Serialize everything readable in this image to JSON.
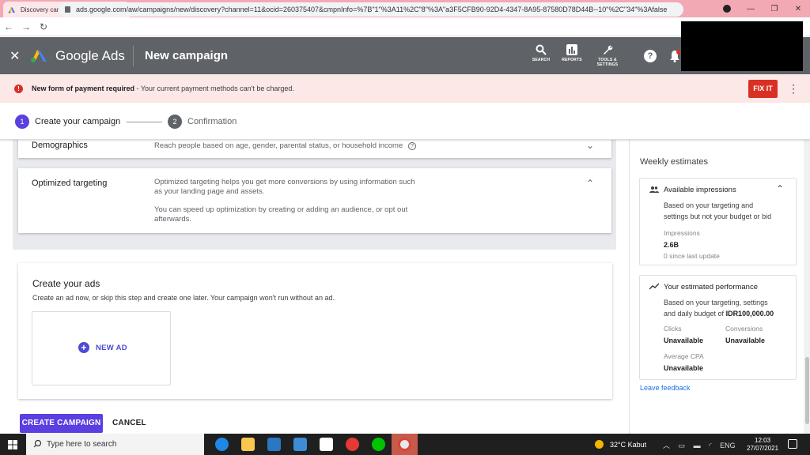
{
  "browser": {
    "tab_title": "Discovery campaign - Getrich - G",
    "url": "ads.google.com/aw/campaigns/new/discovery?channel=11&ocid=260375407&cmpnInfo=%7B\"1\"%3A11%2C\"8\"%3A\"a3F5CFB90-92D4-4347-8A95-87580D78D44B--10\"%2C\"34\"%3Afalse"
  },
  "header": {
    "brand": "Google Ads",
    "page_title": "New campaign",
    "tools": [
      "SEARCH",
      "REPORTS",
      "TOOLS & SETTINGS"
    ]
  },
  "banner": {
    "bold": "New form of payment required",
    "rest": " - Your current payment methods can't be charged.",
    "fix_label": "FIX IT"
  },
  "stepper": {
    "step1_num": "1",
    "step1_label": "Create your campaign",
    "step2_num": "2",
    "step2_label": "Confirmation"
  },
  "targeting": {
    "demographics_label": "Demographics",
    "demographics_desc": "Reach people based on age, gender, parental status, or household income",
    "optimized_label": "Optimized targeting",
    "optimized_desc1_line1": "Optimized targeting helps you get more conversions by using information such",
    "optimized_desc1_line2": "as your landing page and assets.",
    "optimized_desc2_line1": "You can speed up optimization by creating or adding an audience, or opt out",
    "optimized_desc2_line2": "afterwards."
  },
  "ads": {
    "title": "Create your ads",
    "desc": "Create an ad now, or skip this step and create one later. Your campaign won't run without an ad.",
    "new_ad": "NEW AD"
  },
  "actions": {
    "create": "CREATE CAMPAIGN",
    "cancel": "CANCEL"
  },
  "estimates": {
    "title": "Weekly estimates",
    "impressions_head": "Available impressions",
    "impressions_body1": "Based on your targeting and",
    "impressions_body2": "settings but not your budget or bid",
    "impressions_label": "Impressions",
    "impressions_value": "2.6B",
    "impressions_since": "0 since last update",
    "perf_head": "Your estimated performance",
    "perf_body1": "Based on your targeting, settings",
    "perf_body2_prefix": "and daily budget of ",
    "perf_budget": "IDR100,000.00",
    "clicks_label": "Clicks",
    "clicks_value": "Unavailable",
    "conv_label": "Conversions",
    "conv_value": "Unavailable",
    "cpa_label": "Average CPA",
    "cpa_value": "Unavailable",
    "feedback": "Leave feedback"
  },
  "taskbar": {
    "search_placeholder": "Type here to search",
    "weather": "32°C  Kabut",
    "lang": "ENG",
    "time": "12:03",
    "date": "27/07/2021"
  },
  "colors": {
    "primary": "#5b3fe0",
    "error": "#d93025",
    "header_bg": "#5f6368"
  }
}
